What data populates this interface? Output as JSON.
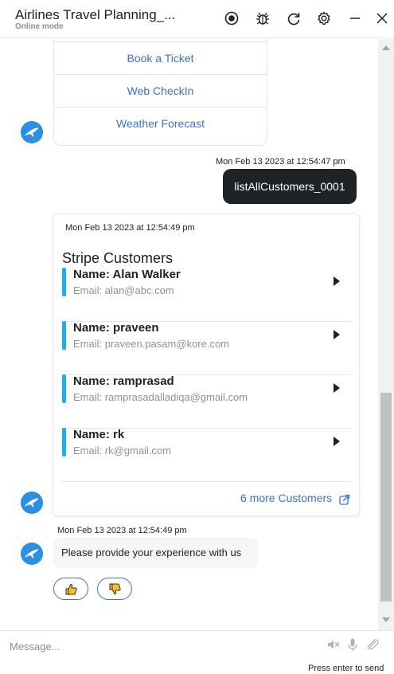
{
  "header": {
    "title": "Airlines Travel Planning_...",
    "subtitle": "Online mode"
  },
  "menu": {
    "items": [
      "Book a Ticket",
      "Web CheckIn",
      "Weather Forecast"
    ]
  },
  "messages": {
    "user_timestamp": "Mon Feb 13 2023 at 12:54:47 pm",
    "user_text": "listAllCustomers_0001",
    "card_timestamp": "Mon Feb 13 2023 at 12:54:49 pm",
    "card_title": "Stripe Customers",
    "customers": [
      {
        "name": "Name: Alan Walker",
        "email": "Email: alan@abc.com"
      },
      {
        "name": "Name: praveen",
        "email": "Email: praveen.pasam@kore.com"
      },
      {
        "name": "Name: ramprasad",
        "email": "Email: ramprasadalladiqa@gmail.com"
      },
      {
        "name": "Name: rk",
        "email": "Email: rk@gmail.com"
      }
    ],
    "more_link": "6 more Customers",
    "feedback_timestamp": "Mon Feb 13 2023 at 12:54:49 pm",
    "feedback_text": "Please provide your experience with us"
  },
  "footer": {
    "placeholder": "Message...",
    "hint": "Press enter to send"
  },
  "colors": {
    "accent_blue": "#3a73c8",
    "customer_bar": "#1eaee8",
    "user_bubble": "#1f2326",
    "avatar": "#2d8fe0"
  },
  "icons": [
    "record-icon",
    "bug-icon",
    "refresh-icon",
    "settings-icon",
    "minimize-icon",
    "close-icon",
    "bot-avatar-icon",
    "thumbs-up-icon",
    "thumbs-down-icon",
    "external-link-icon",
    "speaker-mute-icon",
    "microphone-icon",
    "attachment-icon"
  ]
}
